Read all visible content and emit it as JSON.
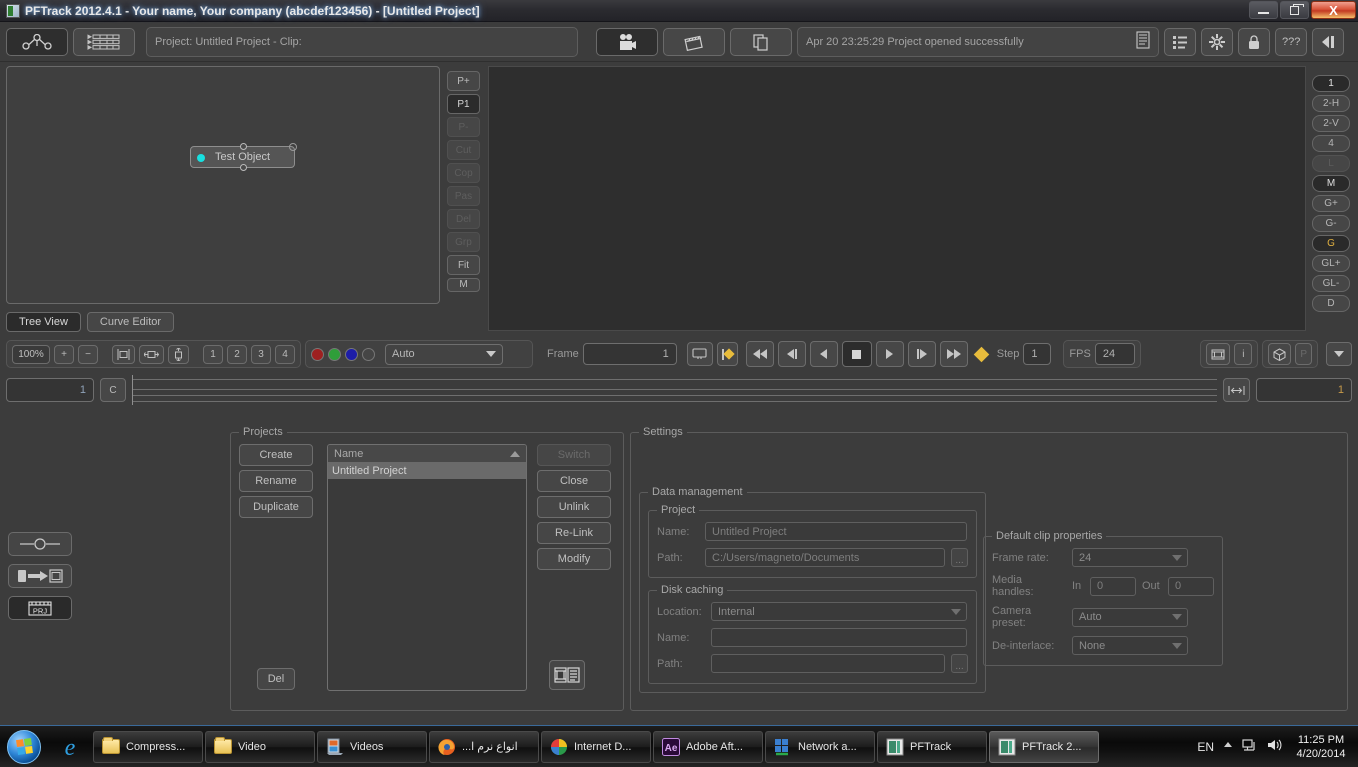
{
  "window": {
    "title": "PFTrack 2012.4.1 - Your name, Your company (abcdef123456) - [Untitled Project]",
    "minimize_label": "Minimize",
    "restore_label": "Restore",
    "close_label": "X"
  },
  "toolbar": {
    "node_graph_icon": "node-graph-icon",
    "list_view_icon": "list-view-icon",
    "project_bar_text": "Project: Untitled Project - Clip:",
    "camera_icon": "camera-icon",
    "clapper_icon": "clapper-icon",
    "file_icon": "file-copy-icon",
    "status_text": "Apr 20 23:25:29 Project opened successfully",
    "status_log_icon": "log-lines-icon",
    "menu_list_icon": "menu-list-icon",
    "gear_icon": "gear-icon",
    "lock_icon": "lock-icon",
    "help_label": "???",
    "exit_icon": "exit-icon"
  },
  "tree": {
    "node_label": "Test Object",
    "side_buttons": [
      {
        "label": "P+",
        "state": "normal"
      },
      {
        "label": "P1",
        "state": "selected"
      },
      {
        "label": "P-",
        "state": "disabled"
      },
      {
        "label": "Cut",
        "state": "disabled"
      },
      {
        "label": "Cop",
        "state": "disabled"
      },
      {
        "label": "Pas",
        "state": "disabled"
      },
      {
        "label": "Del",
        "state": "disabled"
      },
      {
        "label": "Grp",
        "state": "disabled"
      },
      {
        "label": "Fit",
        "state": "normal"
      },
      {
        "label": "M",
        "state": "normal"
      }
    ],
    "tabs": [
      {
        "label": "Tree View",
        "selected": true
      },
      {
        "label": "Curve Editor",
        "selected": false
      }
    ]
  },
  "viewer_buttons": [
    {
      "label": "1",
      "state": "selected"
    },
    {
      "label": "2-H",
      "state": "normal"
    },
    {
      "label": "2-V",
      "state": "normal"
    },
    {
      "label": "4",
      "state": "normal"
    },
    {
      "label": "L",
      "state": "disabled"
    },
    {
      "label": "M",
      "state": "selected"
    },
    {
      "label": "G+",
      "state": "normal"
    },
    {
      "label": "G-",
      "state": "normal"
    },
    {
      "label": "G",
      "state": "gold"
    },
    {
      "label": "GL+",
      "state": "normal"
    },
    {
      "label": "GL-",
      "state": "normal"
    },
    {
      "label": "D",
      "state": "normal"
    }
  ],
  "controls": {
    "zoom_value": "100%",
    "zoom_in_label": "+",
    "zoom_out_label": "−",
    "fit_icon": "fit-to-window-icon",
    "fit_width_icon": "fit-width-icon",
    "fit_height_icon": "fit-height-icon",
    "channels": [
      "1",
      "2",
      "3",
      "4"
    ],
    "color_dots": [
      {
        "name": "red-channel-dot",
        "color": "#9e2020"
      },
      {
        "name": "green-channel-dot",
        "color": "#2f9e3a"
      },
      {
        "name": "blue-channel-dot",
        "color": "#1d1da8"
      },
      {
        "name": "alpha-channel-dot",
        "color": "#4a4a4a"
      }
    ],
    "color_mode": "Auto",
    "frame_label": "Frame",
    "frame_value": "1",
    "monitor_icon": "monitor-icon",
    "key_first_icon": "keyframe-first-icon",
    "rewind_icon": "rewind-icon",
    "prev_key_icon": "prev-keyframe-icon",
    "step_back_icon": "step-back-icon",
    "stop_icon": "stop-icon",
    "play_icon": "play-icon",
    "step_fwd_icon": "step-forward-icon",
    "fast_fwd_icon": "fast-forward-icon",
    "key_add_icon": "add-keyframe-icon",
    "step_label": "Step",
    "step_value": "1",
    "fps_label": "FPS",
    "fps_value": "24",
    "film_icon": "film-strip-icon",
    "info_icon": "info-icon",
    "cube_icon": "cube-3d-icon",
    "p_icon": "p-icon",
    "dropdown_icon": "chevron-down-icon"
  },
  "timeline": {
    "in_value": "1",
    "cache_label": "C",
    "range_icon": "range-width-icon",
    "out_value": "1"
  },
  "rail": {
    "buttons": [
      {
        "name": "node-slider-icon",
        "active": false
      },
      {
        "name": "import-clip-icon",
        "active": false
      },
      {
        "name": "project-clapper-icon",
        "active": true
      }
    ]
  },
  "projects": {
    "legend": "Projects",
    "left_buttons": [
      {
        "label": "Create",
        "enabled": true
      },
      {
        "label": "Rename",
        "enabled": true
      },
      {
        "label": "Duplicate",
        "enabled": true
      }
    ],
    "delete_label": "Del",
    "right_buttons": [
      {
        "label": "Switch",
        "enabled": false
      },
      {
        "label": "Close",
        "enabled": true
      },
      {
        "label": "Unlink",
        "enabled": true
      },
      {
        "label": "Re-Link",
        "enabled": true
      },
      {
        "label": "Modify",
        "enabled": true
      }
    ],
    "list_header": "Name",
    "sort_icon": "sort-ascending-icon",
    "rows": [
      {
        "name": "Untitled Project",
        "selected": true
      }
    ],
    "browse_icon": "clip-browser-icon"
  },
  "settings": {
    "legend": "Settings",
    "data_management": {
      "legend": "Data management",
      "project": {
        "legend": "Project",
        "name_label": "Name:",
        "name_value": "Untitled Project",
        "path_label": "Path:",
        "path_value": "C:/Users/magneto/Documents",
        "browse_label": "..."
      },
      "disk_caching": {
        "legend": "Disk caching",
        "location_label": "Location:",
        "location_value": "Internal",
        "name_label": "Name:",
        "name_value": "",
        "path_label": "Path:",
        "path_value": "",
        "browse_label": "..."
      }
    },
    "default_clip": {
      "legend": "Default clip properties",
      "frame_rate_label": "Frame rate:",
      "frame_rate_value": "24",
      "media_handles_label": "Media handles:",
      "in_label": "In",
      "in_value": "0",
      "out_label": "Out",
      "out_value": "0",
      "camera_preset_label": "Camera preset:",
      "camera_preset_value": "Auto",
      "deinterlace_label": "De-interlace:",
      "deinterlace_value": "None"
    }
  },
  "taskbar": {
    "start_label": "Start",
    "quick_launch": [
      {
        "name": "internet-explorer-icon"
      }
    ],
    "items": [
      {
        "label": "Compress...",
        "icon": "folder-icon",
        "active": false
      },
      {
        "label": "Video",
        "icon": "folder-icon",
        "active": false
      },
      {
        "label": "Videos",
        "icon": "media-library-icon",
        "active": false
      },
      {
        "label": "انواع نرم ا...",
        "icon": "firefox-icon",
        "active": false
      },
      {
        "label": "Internet D...",
        "icon": "idm-icon",
        "active": false
      },
      {
        "label": "Adobe Aft...",
        "icon": "after-effects-icon",
        "active": false
      },
      {
        "label": "Network a...",
        "icon": "network-icon",
        "active": false
      },
      {
        "label": "PFTrack",
        "icon": "pftrack-icon",
        "active": false
      },
      {
        "label": "PFTrack 2...",
        "icon": "pftrack-icon",
        "active": true
      }
    ],
    "language": "EN",
    "show_hidden_icon": "chevron-up-icon",
    "network_icon": "network-tray-icon",
    "volume_icon": "volume-icon",
    "time": "11:25 PM",
    "date": "4/20/2014"
  }
}
